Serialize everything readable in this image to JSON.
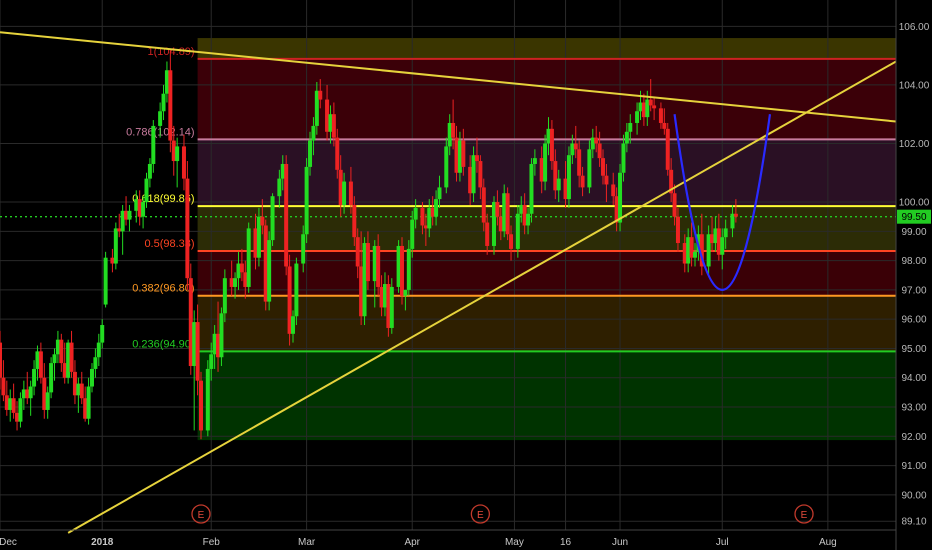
{
  "chart_data": {
    "type": "candlestick",
    "y_axis": {
      "ticks": [
        "106.00",
        "104.00",
        "102.00",
        "100.00",
        "99.00",
        "98.00",
        "97.00",
        "96.00",
        "95.00",
        "94.00",
        "93.00",
        "92.00",
        "91.00",
        "90.00",
        "89.10"
      ],
      "tick_values": [
        106,
        104,
        102,
        100,
        99,
        98,
        97,
        96,
        95,
        94,
        93,
        92,
        91,
        90,
        89.1
      ],
      "range": [
        88.8,
        106.9
      ]
    },
    "x_axis": {
      "labels": [
        "Dec",
        "2018",
        "Feb",
        "Mar",
        "Apr",
        "May",
        "16",
        "Jun",
        "Jul",
        "Aug"
      ],
      "label_days": [
        0,
        30,
        62,
        90,
        121,
        151,
        166,
        182,
        212,
        243
      ],
      "range_days": [
        0,
        263
      ]
    },
    "last_price": {
      "label": "99.50",
      "value": 99.5,
      "color": "#22cc22"
    },
    "fib_levels": [
      {
        "label": "1(104.89)",
        "value": 104.89,
        "color": "#cc2222"
      },
      {
        "label": "0.786(102.14)",
        "value": 102.14,
        "color": "#c97c9e"
      },
      {
        "label": "0.618(99.86)",
        "value": 99.86,
        "color": "#ffff33"
      },
      {
        "label": "0.5(98.33)",
        "value": 98.33,
        "color": "#ff4422"
      },
      {
        "label": "0.382(96.80)",
        "value": 96.8,
        "color": "#ff9922"
      },
      {
        "label": "0.236(94.90)",
        "value": 94.9,
        "color": "#22cc22"
      }
    ],
    "fib_zone_bottom": 91.87,
    "fib_zone_start_day": 58,
    "fib_zones": [
      {
        "from": 105.6,
        "to": 104.89,
        "color": "#3a3500"
      },
      {
        "from": 104.89,
        "to": 102.14,
        "color": "#3b0008"
      },
      {
        "from": 102.14,
        "to": 99.86,
        "color": "#2a1024"
      },
      {
        "from": 99.86,
        "to": 98.33,
        "color": "#2c2c06"
      },
      {
        "from": 98.33,
        "to": 96.8,
        "color": "#3a0006"
      },
      {
        "from": 96.8,
        "to": 94.9,
        "color": "#2e1f00"
      },
      {
        "from": 94.9,
        "to": 91.87,
        "color": "#003300"
      }
    ],
    "trendlines": [
      {
        "name": "descending",
        "from": [
          0,
          105.8
        ],
        "to": [
          263,
          102.75
        ],
        "color": "#e6d33c"
      },
      {
        "name": "ascending",
        "from": [
          20,
          88.7
        ],
        "to": [
          263,
          104.8
        ],
        "color": "#e6d33c"
      }
    ],
    "cup_curve": {
      "points": [
        [
          198,
          103.0
        ],
        [
          212,
          97.0
        ],
        [
          226,
          103.0
        ]
      ],
      "color": "#2a2aff"
    },
    "earnings_markers": [
      {
        "label": "E",
        "day": 59
      },
      {
        "label": "E",
        "day": 141
      },
      {
        "label": "E",
        "day": 236
      }
    ],
    "candles": [
      [
        0,
        95.2,
        95.6,
        93.6,
        94.0
      ],
      [
        1,
        94.0,
        94.6,
        93.2,
        93.4
      ],
      [
        2,
        93.4,
        93.9,
        92.7,
        92.9
      ],
      [
        3,
        92.9,
        93.6,
        92.5,
        93.3
      ],
      [
        4,
        93.3,
        93.8,
        92.6,
        92.8
      ],
      [
        5,
        92.8,
        93.2,
        92.2,
        92.5
      ],
      [
        6,
        92.5,
        93.5,
        92.3,
        93.3
      ],
      [
        7,
        93.3,
        93.9,
        92.9,
        93.6
      ],
      [
        8,
        93.6,
        94.2,
        93.1,
        93.3
      ],
      [
        9,
        93.3,
        93.9,
        92.7,
        93.7
      ],
      [
        10,
        93.7,
        94.6,
        93.4,
        94.3
      ],
      [
        11,
        94.3,
        95.1,
        93.9,
        94.9
      ],
      [
        12,
        94.9,
        95.2,
        93.8,
        94.0
      ],
      [
        13,
        94.0,
        94.5,
        92.6,
        92.9
      ],
      [
        14,
        92.9,
        93.7,
        92.6,
        93.5
      ],
      [
        15,
        93.5,
        94.7,
        93.3,
        94.5
      ],
      [
        16,
        94.5,
        95.0,
        93.9,
        94.8
      ],
      [
        17,
        94.8,
        95.6,
        94.5,
        95.3
      ],
      [
        18,
        95.3,
        95.5,
        94.2,
        94.5
      ],
      [
        19,
        94.5,
        95.2,
        93.8,
        94.0
      ],
      [
        20,
        94.0,
        95.3,
        93.8,
        95.2
      ],
      [
        21,
        95.2,
        95.6,
        94.0,
        94.2
      ],
      [
        22,
        94.2,
        94.6,
        93.1,
        93.4
      ],
      [
        23,
        93.4,
        94.0,
        92.8,
        93.8
      ],
      [
        24,
        93.8,
        94.2,
        93.1,
        93.3
      ],
      [
        25,
        93.3,
        93.7,
        92.5,
        92.6
      ],
      [
        26,
        92.6,
        94.0,
        92.4,
        93.7
      ],
      [
        27,
        93.7,
        94.5,
        93.5,
        94.3
      ],
      [
        28,
        94.3,
        95.0,
        94.0,
        94.7
      ],
      [
        29,
        94.7,
        95.5,
        94.4,
        95.2
      ],
      [
        30,
        95.2,
        96.0,
        95.0,
        95.8
      ],
      [
        31,
        96.5,
        98.3,
        96.4,
        98.1
      ],
      [
        33,
        98.1,
        98.4,
        97.6,
        97.9
      ],
      [
        34,
        97.9,
        99.3,
        97.7,
        99.1
      ],
      [
        35,
        99.1,
        99.6,
        98.8,
        99.0
      ],
      [
        36,
        99.0,
        99.9,
        98.2,
        99.7
      ],
      [
        37,
        99.7,
        100.2,
        99.2,
        99.4
      ],
      [
        38,
        99.4,
        99.9,
        99.0,
        99.7
      ],
      [
        40,
        99.7,
        100.4,
        99.3,
        100.1
      ],
      [
        41,
        100.1,
        100.4,
        99.2,
        99.5
      ],
      [
        42,
        99.5,
        100.2,
        99.1,
        100.0
      ],
      [
        43,
        100.0,
        101.0,
        99.8,
        100.8
      ],
      [
        44,
        100.8,
        101.5,
        100.5,
        101.3
      ],
      [
        45,
        101.3,
        102.8,
        101.0,
        102.6
      ],
      [
        47,
        102.6,
        103.4,
        102.2,
        103.1
      ],
      [
        48,
        103.1,
        104.0,
        102.8,
        103.7
      ],
      [
        49,
        103.7,
        104.8,
        103.4,
        104.5
      ],
      [
        50,
        104.5,
        105.2,
        101.7,
        102.1
      ],
      [
        51,
        102.1,
        102.6,
        100.9,
        101.4
      ],
      [
        52,
        101.4,
        102.2,
        100.5,
        101.9
      ],
      [
        54,
        101.9,
        102.3,
        100.4,
        100.8
      ],
      [
        55,
        100.8,
        101.4,
        97.0,
        97.4
      ],
      [
        56,
        97.4,
        97.9,
        94.1,
        94.4
      ],
      [
        57,
        94.4,
        96.3,
        92.2,
        95.9
      ],
      [
        58,
        95.9,
        96.5,
        93.4,
        93.9
      ],
      [
        59,
        93.9,
        94.2,
        91.9,
        92.2
      ],
      [
        61,
        92.2,
        94.6,
        92.0,
        94.3
      ],
      [
        62,
        94.3,
        95.2,
        93.9,
        94.8
      ],
      [
        63,
        94.8,
        95.8,
        94.3,
        95.5
      ],
      [
        64,
        95.5,
        96.6,
        94.2,
        94.7
      ],
      [
        65,
        94.7,
        96.4,
        94.4,
        96.2
      ],
      [
        66,
        96.2,
        97.7,
        95.9,
        97.4
      ],
      [
        68,
        97.4,
        98.0,
        96.8,
        97.1
      ],
      [
        69,
        97.1,
        97.6,
        96.7,
        97.4
      ],
      [
        70,
        97.4,
        98.3,
        97.0,
        97.9
      ],
      [
        71,
        97.9,
        98.4,
        97.3,
        97.6
      ],
      [
        72,
        97.6,
        98.0,
        96.7,
        97.1
      ],
      [
        73,
        97.1,
        99.3,
        96.9,
        99.1
      ],
      [
        75,
        99.1,
        99.6,
        97.7,
        98.1
      ],
      [
        76,
        98.1,
        99.8,
        97.8,
        99.5
      ],
      [
        77,
        99.5,
        100.1,
        98.9,
        99.2
      ],
      [
        78,
        99.2,
        99.4,
        96.3,
        96.6
      ],
      [
        79,
        96.6,
        99.0,
        96.3,
        98.7
      ],
      [
        80,
        98.7,
        100.3,
        98.5,
        100.2
      ],
      [
        82,
        100.2,
        101.1,
        99.8,
        100.8
      ],
      [
        83,
        100.8,
        101.6,
        100.4,
        101.3
      ],
      [
        84,
        101.3,
        101.6,
        97.5,
        97.8
      ],
      [
        85,
        97.8,
        98.2,
        95.1,
        95.5
      ],
      [
        86,
        95.5,
        96.3,
        95.2,
        96.1
      ],
      [
        87,
        96.1,
        98.1,
        95.8,
        97.9
      ],
      [
        89,
        97.9,
        99.2,
        97.6,
        98.9
      ],
      [
        90,
        98.9,
        101.5,
        98.6,
        101.2
      ],
      [
        91,
        101.2,
        102.4,
        100.9,
        102.1
      ],
      [
        92,
        102.1,
        102.9,
        101.6,
        102.6
      ],
      [
        93,
        102.6,
        104.1,
        102.3,
        103.8
      ],
      [
        94,
        103.8,
        104.2,
        103.2,
        103.5
      ],
      [
        96,
        103.5,
        104.0,
        102.1,
        102.4
      ],
      [
        97,
        102.4,
        103.3,
        102.0,
        103.0
      ],
      [
        98,
        103.0,
        103.4,
        101.9,
        102.2
      ],
      [
        99,
        102.2,
        102.5,
        100.8,
        101.1
      ],
      [
        100,
        101.1,
        101.6,
        99.5,
        99.9
      ],
      [
        101,
        99.9,
        101.0,
        99.6,
        100.7
      ],
      [
        103,
        100.7,
        101.2,
        99.6,
        99.9
      ],
      [
        104,
        99.9,
        100.2,
        98.5,
        98.8
      ],
      [
        105,
        98.8,
        99.1,
        97.4,
        97.8
      ],
      [
        106,
        97.8,
        99.0,
        95.8,
        96.1
      ],
      [
        107,
        96.1,
        98.8,
        95.8,
        98.6
      ],
      [
        108,
        98.6,
        99.0,
        97.0,
        97.3
      ],
      [
        110,
        97.3,
        98.7,
        96.4,
        98.5
      ],
      [
        111,
        98.5,
        98.9,
        96.8,
        97.1
      ],
      [
        112,
        97.1,
        97.5,
        96.1,
        96.4
      ],
      [
        113,
        96.4,
        97.6,
        96.1,
        97.2
      ],
      [
        114,
        97.2,
        97.5,
        95.4,
        95.7
      ],
      [
        115,
        95.7,
        97.4,
        95.5,
        97.1
      ],
      [
        117,
        97.1,
        98.7,
        96.9,
        98.5
      ],
      [
        118,
        98.5,
        98.8,
        96.5,
        96.8
      ],
      [
        119,
        96.8,
        97.0,
        96.3,
        97.0
      ],
      [
        120,
        97.0,
        98.7,
        96.8,
        98.4
      ],
      [
        121,
        98.4,
        99.7,
        98.1,
        99.4
      ],
      [
        122,
        99.4,
        100.1,
        99.1,
        99.8
      ],
      [
        124,
        99.8,
        100.0,
        98.9,
        99.2
      ],
      [
        125,
        99.2,
        99.6,
        98.5,
        99.1
      ],
      [
        126,
        99.1,
        100.1,
        98.8,
        99.8
      ],
      [
        127,
        99.8,
        100.2,
        99.2,
        99.5
      ],
      [
        128,
        99.5,
        100.4,
        99.2,
        100.1
      ],
      [
        129,
        100.1,
        100.9,
        99.8,
        100.5
      ],
      [
        131,
        100.5,
        102.2,
        100.3,
        101.9
      ],
      [
        132,
        101.9,
        103.0,
        101.6,
        102.7
      ],
      [
        133,
        102.7,
        103.5,
        101.8,
        102.2
      ],
      [
        134,
        102.2,
        102.6,
        100.7,
        101.0
      ],
      [
        135,
        101.0,
        102.4,
        100.7,
        102.1
      ],
      [
        136,
        102.1,
        102.5,
        100.9,
        101.2
      ],
      [
        138,
        101.2,
        101.6,
        99.9,
        100.3
      ],
      [
        139,
        100.3,
        101.9,
        100.0,
        101.6
      ],
      [
        140,
        101.6,
        102.2,
        101.0,
        101.4
      ],
      [
        141,
        101.4,
        101.6,
        100.1,
        100.5
      ],
      [
        142,
        100.5,
        100.8,
        99.0,
        99.3
      ],
      [
        143,
        99.3,
        99.6,
        98.2,
        98.5
      ],
      [
        145,
        98.5,
        100.2,
        98.2,
        100.0
      ],
      [
        146,
        100.0,
        100.4,
        99.2,
        99.5
      ],
      [
        147,
        99.5,
        99.8,
        98.7,
        99.0
      ],
      [
        148,
        99.0,
        100.6,
        98.8,
        100.3
      ],
      [
        149,
        100.3,
        100.5,
        98.7,
        98.9
      ],
      [
        150,
        98.9,
        99.2,
        98.0,
        98.4
      ],
      [
        152,
        98.4,
        99.9,
        98.1,
        99.6
      ],
      [
        153,
        99.6,
        100.2,
        99.3,
        99.9
      ],
      [
        154,
        99.9,
        100.3,
        98.9,
        99.2
      ],
      [
        155,
        99.2,
        99.8,
        98.9,
        99.6
      ],
      [
        156,
        99.6,
        101.5,
        99.3,
        101.3
      ],
      [
        157,
        101.3,
        101.8,
        100.9,
        101.5
      ],
      [
        159,
        101.5,
        101.9,
        100.3,
        100.7
      ],
      [
        160,
        100.7,
        102.3,
        100.4,
        102.0
      ],
      [
        161,
        102.0,
        102.9,
        101.6,
        102.5
      ],
      [
        162,
        102.5,
        102.8,
        101.1,
        101.4
      ],
      [
        163,
        101.4,
        101.8,
        100.1,
        100.4
      ],
      [
        164,
        100.4,
        101.1,
        100.0,
        100.8
      ],
      [
        166,
        100.8,
        101.4,
        99.8,
        100.1
      ],
      [
        167,
        100.1,
        101.9,
        99.8,
        101.6
      ],
      [
        168,
        101.6,
        102.3,
        101.3,
        102.0
      ],
      [
        169,
        102.0,
        102.6,
        101.5,
        101.8
      ],
      [
        170,
        101.8,
        102.1,
        100.5,
        100.9
      ],
      [
        171,
        100.9,
        101.2,
        100.2,
        100.5
      ],
      [
        173,
        100.5,
        102.1,
        100.3,
        101.8
      ],
      [
        174,
        101.8,
        102.5,
        101.5,
        102.2
      ],
      [
        175,
        102.2,
        102.6,
        101.7,
        102.0
      ],
      [
        176,
        102.0,
        102.4,
        101.2,
        101.5
      ],
      [
        177,
        101.5,
        101.8,
        100.6,
        100.9
      ],
      [
        178,
        100.9,
        101.3,
        100.0,
        100.6
      ],
      [
        180,
        100.6,
        101.0,
        99.9,
        100.2
      ],
      [
        181,
        100.2,
        100.5,
        99.0,
        99.3
      ],
      [
        182,
        99.3,
        101.3,
        99.0,
        101.0
      ],
      [
        183,
        101.0,
        102.3,
        100.7,
        102.0
      ],
      [
        184,
        102.0,
        102.7,
        101.7,
        102.4
      ],
      [
        185,
        102.4,
        103.0,
        102.0,
        102.7
      ],
      [
        187,
        102.7,
        103.4,
        102.3,
        103.1
      ],
      [
        188,
        103.1,
        103.8,
        102.8,
        103.4
      ],
      [
        189,
        103.4,
        103.7,
        102.6,
        102.9
      ],
      [
        190,
        102.9,
        103.8,
        102.6,
        103.5
      ],
      [
        191,
        103.5,
        104.2,
        103.1,
        103.3
      ],
      [
        192,
        103.3,
        103.6,
        102.8,
        103.2
      ],
      [
        194,
        103.2,
        103.4,
        102.5,
        102.7
      ],
      [
        195,
        102.7,
        103.2,
        102.3,
        102.5
      ],
      [
        196,
        102.5,
        102.7,
        100.9,
        101.1
      ],
      [
        197,
        101.1,
        101.5,
        100.0,
        100.3
      ],
      [
        198,
        100.3,
        100.6,
        99.2,
        99.5
      ],
      [
        199,
        99.5,
        99.8,
        98.3,
        98.6
      ],
      [
        201,
        98.6,
        98.9,
        97.6,
        97.9
      ],
      [
        202,
        97.9,
        99.1,
        97.6,
        98.8
      ],
      [
        203,
        98.8,
        99.3,
        97.8,
        98.1
      ],
      [
        204,
        98.1,
        98.6,
        97.8,
        98.3
      ],
      [
        205,
        98.3,
        99.2,
        98.0,
        98.9
      ],
      [
        206,
        98.9,
        99.6,
        97.5,
        97.8
      ],
      [
        208,
        97.8,
        99.2,
        97.5,
        98.9
      ],
      [
        209,
        98.9,
        99.5,
        98.3,
        98.6
      ],
      [
        210,
        98.6,
        99.5,
        98.3,
        99.1
      ],
      [
        211,
        99.1,
        99.6,
        98.0,
        98.2
      ],
      [
        212,
        98.2,
        99.1,
        97.7,
        98.8
      ],
      [
        213,
        98.8,
        99.4,
        98.4,
        99.1
      ],
      [
        215,
        99.1,
        99.9,
        98.8,
        99.6
      ],
      [
        216,
        99.6,
        100.1,
        99.3,
        99.5
      ]
    ]
  }
}
